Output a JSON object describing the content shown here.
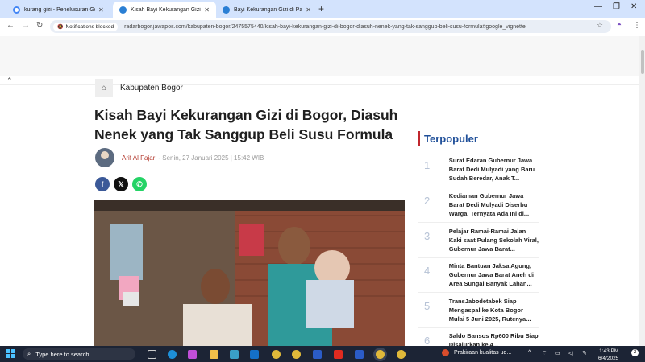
{
  "browser": {
    "tabs": [
      {
        "label": "kurang gizi - Penelusuran Goog",
        "favicon_color": "#4285f4",
        "active": false
      },
      {
        "label": "Kisah Bayi Kekurangan Gizi di B",
        "favicon_color": "#2a7fd4",
        "active": true
      },
      {
        "label": "Bayi Kekurangan Gizi di Parung",
        "favicon_color": "#2a7fd4",
        "active": false
      }
    ],
    "notifications_blocked": "Notifications blocked",
    "url": "radarbogor.jawapos.com/kabupaten-bogor/2475575440/kisah-bayi-kekurangan-gizi-di-bogor-diasuh-nenek-yang-tak-sanggup-beli-susu-formula#google_vignette"
  },
  "article": {
    "breadcrumb": "Kabupaten Bogor",
    "title": "Kisah Bayi Kekurangan Gizi di Bogor, Diasuh Nenek yang Tak Sanggup Beli Susu Formula",
    "author": "Arif Al Fajar",
    "meta": "- Senin, 27 Januari 2025 | 15:42 WIB",
    "share": [
      {
        "name": "facebook",
        "glyph": "f",
        "color": "#3b5998"
      },
      {
        "name": "x",
        "glyph": "𝕏",
        "color": "#111111"
      },
      {
        "name": "whatsapp",
        "glyph": "✆",
        "color": "#25d366"
      }
    ]
  },
  "sidebar": {
    "title": "Terpopuler",
    "items": [
      {
        "num": "1",
        "text": "Surat Edaran Gubernur Jawa Barat Dedi Mulyadi yang Baru Sudah Beredar, Anak T..."
      },
      {
        "num": "2",
        "text": "Kediaman Gubernur Jawa Barat Dedi Mulyadi Diserbu Warga, Ternyata Ada Ini di..."
      },
      {
        "num": "3",
        "text": "Pelajar Ramai-Ramai Jalan Kaki saat Pulang Sekolah Viral, Gubernur Jawa Barat..."
      },
      {
        "num": "4",
        "text": "Minta Bantuan Jaksa Agung, Gubernur Jawa Barat Aneh di Area Sungai Banyak Lahan..."
      },
      {
        "num": "5",
        "text": "TransJabodetabek Siap Mengaspal ke Kota Bogor Mulai 5 Juni 2025, Rutenya..."
      },
      {
        "num": "6",
        "text": "Saldo Bansos Rp600 Ribu Siap Disalurkan ke 4..."
      }
    ]
  },
  "taskbar": {
    "search_placeholder": "Type here to search",
    "weather": "Prakiraan kualitas ud...",
    "time": "1:43 PM",
    "date": "6/4/2025",
    "notification_count": "2"
  }
}
